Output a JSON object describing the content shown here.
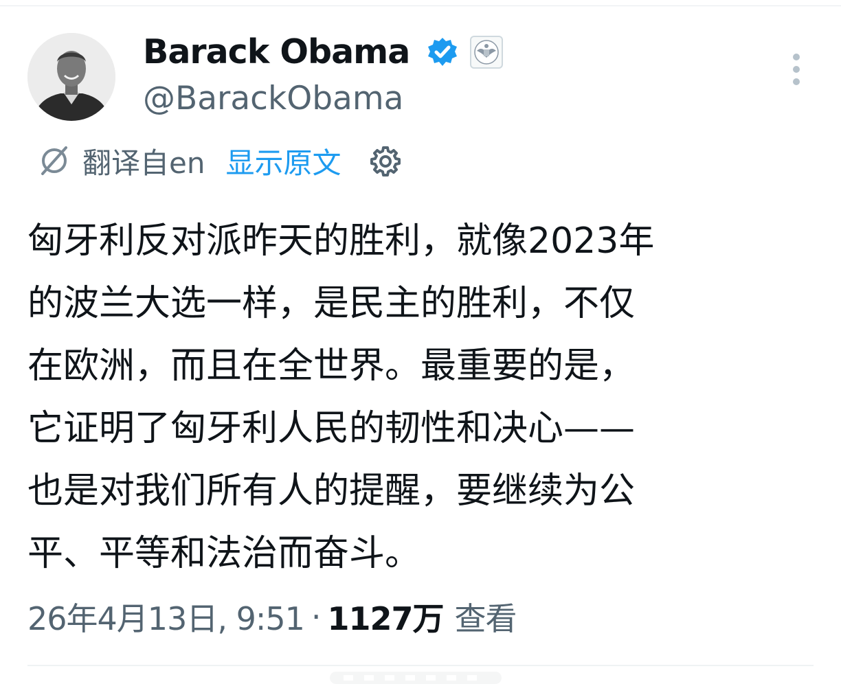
{
  "author": {
    "display_name": "Barack Obama",
    "handle": "@BarackObama",
    "avatar_icon": "profile-photo",
    "verified_icon": "verified-badge-icon",
    "affiliation_icon": "government-seal-icon"
  },
  "translation_bar": {
    "translated_from": "翻译自en",
    "show_original_label": "显示原文",
    "translate_icon": "translate-icon",
    "settings_icon": "gear-icon"
  },
  "tweet": {
    "text": "匈牙利反对派昨天的胜利，就像2023年\n的波兰大选一样，是民主的胜利，不仅\n在欧洲，而且在全世界。最重要的是，\n它证明了匈牙利人民的韧性和决心——\n也是对我们所有人的提醒，要继续为公\n平、平等和法治而奋斗。",
    "timestamp": "26年4月13日, 9:51",
    "separator": "·",
    "view_count": "1127万",
    "view_label": "查看"
  },
  "colors": {
    "text_primary": "#0f1419",
    "text_secondary": "#536471",
    "accent_blue": "#1d9bf0",
    "divider": "#eff3f4"
  }
}
